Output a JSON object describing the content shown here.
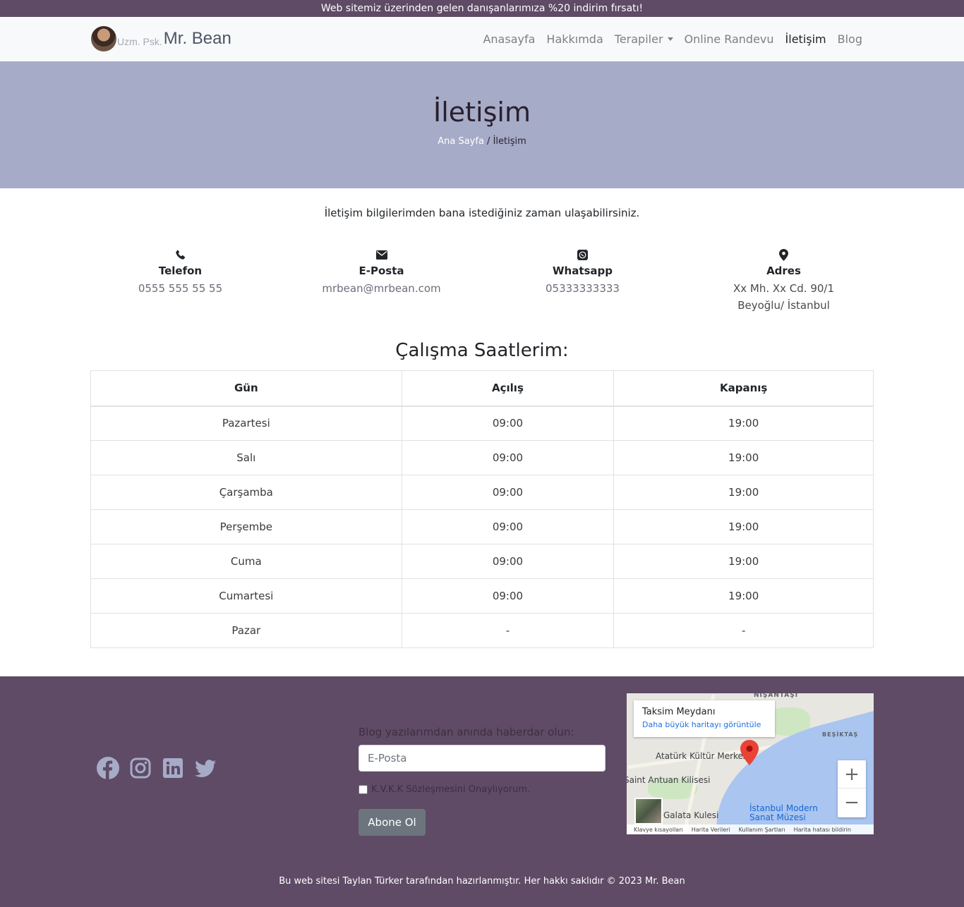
{
  "announcement": "Web sitemiz üzerinden gelen danışanlarımıza %20 indirim fırsatı!",
  "brand": {
    "prefix": "Uzm. Psk.",
    "name": "Mr. Bean"
  },
  "nav": {
    "items": [
      "Anasayfa",
      "Hakkımda",
      "Terapiler",
      "Online Randevu",
      "İletişim",
      "Blog"
    ],
    "active": "İletişim"
  },
  "hero": {
    "title": "İletişim",
    "breadcrumb_home": "Ana Sayfa",
    "breadcrumb_sep": " / ",
    "breadcrumb_current": "İletişim"
  },
  "intro": "İletişim bilgilerimden bana istediğiniz zaman ulaşabilirsiniz.",
  "contacts": [
    {
      "icon": "phone-icon",
      "label": "Telefon",
      "value": "0555 555 55 55"
    },
    {
      "icon": "envelope-icon",
      "label": "E-Posta",
      "value": "mrbean@mrbean.com"
    },
    {
      "icon": "whatsapp-icon",
      "label": "Whatsapp",
      "value": "05333333333"
    },
    {
      "icon": "map-marker-icon",
      "label": "Adres",
      "value": "Xx Mh. Xx Cd. 90/1 Beyoğlu/ İstanbul"
    }
  ],
  "hours": {
    "title": "Çalışma Saatlerim:",
    "headers": [
      "Gün",
      "Açılış",
      "Kapanış"
    ],
    "rows": [
      [
        "Pazartesi",
        "09:00",
        "19:00"
      ],
      [
        "Salı",
        "09:00",
        "19:00"
      ],
      [
        "Çarşamba",
        "09:00",
        "19:00"
      ],
      [
        "Perşembe",
        "09:00",
        "19:00"
      ],
      [
        "Cuma",
        "09:00",
        "19:00"
      ],
      [
        "Cumartesi",
        "09:00",
        "19:00"
      ],
      [
        "Pazar",
        "-",
        "-"
      ]
    ]
  },
  "footer": {
    "socials": [
      "facebook-icon",
      "instagram-icon",
      "linkedin-icon",
      "twitter-icon"
    ],
    "newsletter_label": "Blog yazılarımdan anında haberdar olun:",
    "email_placeholder": "E-Posta",
    "kvkk_label": "K.V.K.K Sözleşmesini Onaylıyorum.",
    "subscribe_label": "Abone Ol",
    "copyright": "Bu web sitesi Taylan Türker tarafından hazırlanmıştır. Her hakkı saklıdır © 2023 Mr. Bean"
  },
  "map": {
    "place": "Taksim Meydanı",
    "link": "Daha büyük haritayı görüntüle",
    "labels": [
      "NİŞANTAŞI",
      "BEŞİKTAŞ",
      "Atatürk Kültür Merkezi",
      "Saint Antuan Kilisesi",
      "Galata Kulesi",
      "İstanbul Modern Sanat Müzesi"
    ],
    "footer": [
      "Klavye kısayolları",
      "Harita Verileri",
      "Kullanım Şartları",
      "Harita hatası bildirin"
    ]
  },
  "colors": {
    "announce_bg": "#5f4b66",
    "hero_bg": "#a6abc7",
    "footer_bg": "#5f4b66"
  }
}
